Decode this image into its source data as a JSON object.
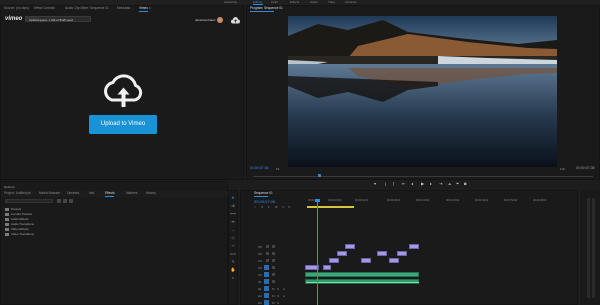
{
  "workspaces": [
    "Assembly",
    "Editing",
    "Color",
    "Effects",
    "Audio",
    "Titles",
    "Libraries"
  ],
  "workspace_active": "Editing",
  "source_tabs": [
    "Source: (no clips)",
    "Effect Controls",
    "Audio Clip Mixer: Sequence 01",
    "Metadata",
    "Vimeo"
  ],
  "vimeo": {
    "quota": "Upload quota: 1 GB of 5GB used",
    "quota_value": 0.2,
    "logo": "vimeo",
    "username": "danieltorobaker",
    "upload_label": "Upload to Vimeo",
    "refresh_label": "Refresh"
  },
  "program": {
    "tab": "Program: Sequence 01",
    "timecode_left": "00;00;07;08",
    "fit": "Fit",
    "quality": "Full",
    "timecode_right": "00;00;07;08",
    "playhead_fraction": 0.19
  },
  "project_tabs": [
    "Project: Untitled.prl",
    "Media Browser",
    "Libraries",
    "Info",
    "Effects",
    "Markers",
    "History"
  ],
  "effects_folders": [
    "Presets",
    "Lumetri Presets",
    "Audio Effects",
    "Audio Transitions",
    "Video Effects",
    "Video Transitions"
  ],
  "timeline": {
    "tab": "Sequence 01",
    "timecode": "00;00;07;08",
    "ruler": [
      "00;00",
      "00;00;16;00",
      "00;00;32;00",
      "00;00;48;00",
      "00;01;04;02",
      "00;01;20;02",
      "00;01;36;02",
      "00;01;52;02",
      "00;02;08;04"
    ],
    "tracks": [
      "V6",
      "V5",
      "V4",
      "V3",
      "V2",
      "V1",
      "A1",
      "A2",
      "A3"
    ]
  },
  "colors": {
    "accent": "#2d8ceb",
    "vimeo_button": "#1a92d6",
    "clip_video": "#a49ae0",
    "clip_audio": "#2e9c68"
  }
}
